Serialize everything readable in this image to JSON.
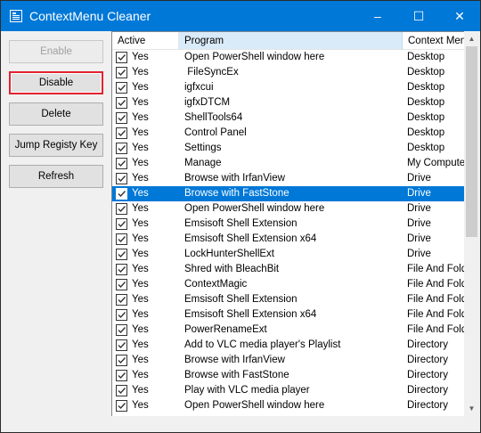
{
  "window": {
    "title": "ContextMenu Cleaner",
    "accent": "#0078d7"
  },
  "titlebar_buttons": {
    "minimize": "–",
    "maximize": "☐",
    "close": "✕"
  },
  "buttons": {
    "enable": "Enable",
    "disable": "Disable",
    "delete": "Delete",
    "jump": "Jump Registy Key",
    "refresh": "Refresh"
  },
  "columns": {
    "active": "Active",
    "program": "Program",
    "context": "Context Menu"
  },
  "rows": [
    {
      "active": "Yes",
      "program": "Open PowerShell window here",
      "context": "Desktop"
    },
    {
      "active": "Yes",
      "program": " FileSyncEx",
      "context": "Desktop"
    },
    {
      "active": "Yes",
      "program": "igfxcui",
      "context": "Desktop"
    },
    {
      "active": "Yes",
      "program": "igfxDTCM",
      "context": "Desktop"
    },
    {
      "active": "Yes",
      "program": "ShellTools64",
      "context": "Desktop"
    },
    {
      "active": "Yes",
      "program": "Control Panel",
      "context": "Desktop"
    },
    {
      "active": "Yes",
      "program": "Settings",
      "context": "Desktop"
    },
    {
      "active": "Yes",
      "program": "Manage",
      "context": "My Computer"
    },
    {
      "active": "Yes",
      "program": "Browse with IrfanView",
      "context": "Drive"
    },
    {
      "active": "Yes",
      "program": "Browse with FastStone",
      "context": "Drive",
      "selected": true
    },
    {
      "active": "Yes",
      "program": "Open PowerShell window here",
      "context": "Drive"
    },
    {
      "active": "Yes",
      "program": "Emsisoft Shell Extension",
      "context": "Drive"
    },
    {
      "active": "Yes",
      "program": "Emsisoft Shell Extension x64",
      "context": "Drive"
    },
    {
      "active": "Yes",
      "program": "LockHunterShellExt",
      "context": "Drive"
    },
    {
      "active": "Yes",
      "program": "Shred with BleachBit",
      "context": "File And Folder"
    },
    {
      "active": "Yes",
      "program": "ContextMagic",
      "context": "File And Folder"
    },
    {
      "active": "Yes",
      "program": "Emsisoft Shell Extension",
      "context": "File And Folder"
    },
    {
      "active": "Yes",
      "program": "Emsisoft Shell Extension x64",
      "context": "File And Folder"
    },
    {
      "active": "Yes",
      "program": "PowerRenameExt",
      "context": "File And Folder"
    },
    {
      "active": "Yes",
      "program": "Add to VLC media player's Playlist",
      "context": "Directory"
    },
    {
      "active": "Yes",
      "program": "Browse with IrfanView",
      "context": "Directory"
    },
    {
      "active": "Yes",
      "program": "Browse with FastStone",
      "context": "Directory"
    },
    {
      "active": "Yes",
      "program": "Play with VLC media player",
      "context": "Directory"
    },
    {
      "active": "Yes",
      "program": "Open PowerShell window here",
      "context": "Directory"
    }
  ]
}
